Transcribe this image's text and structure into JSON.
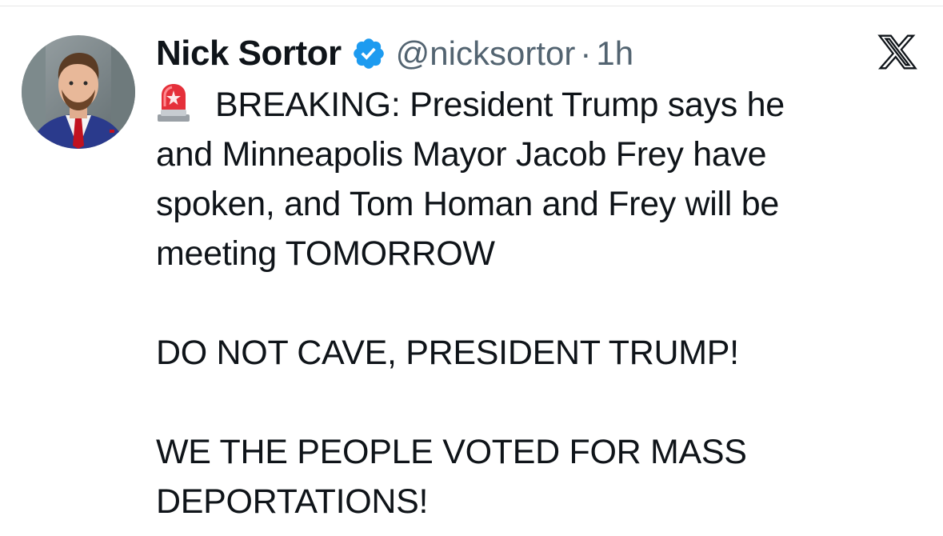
{
  "author": {
    "display_name": "Nick Sortor",
    "handle": "@nicksortor",
    "separator": "·",
    "time": "1h",
    "verified_color": "#1d9bf0",
    "avatar_icon": "profile-photo"
  },
  "brand": {
    "logo_icon": "x-logo-icon"
  },
  "tweet": {
    "emoji_icon": "police-siren-emoji",
    "line1": "BREAKING: President Trump says he",
    "line2": "and Minneapolis Mayor Jacob Frey have",
    "line3": "spoken, and Tom Homan and Frey will be",
    "line4": "meeting TOMORROW",
    "line5": "DO NOT CAVE, PRESIDENT TRUMP!",
    "line6": "WE THE PEOPLE VOTED FOR MASS",
    "line7": "DEPORTATIONS!"
  }
}
